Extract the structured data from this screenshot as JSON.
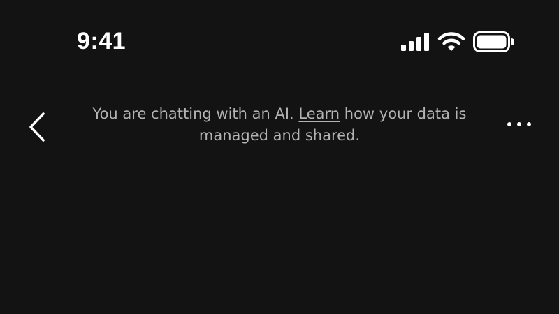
{
  "status_bar": {
    "time": "9:41",
    "icons": [
      "cellular-signal-icon",
      "wifi-icon",
      "battery-icon"
    ]
  },
  "header": {
    "back_icon": "chevron-left-icon",
    "more_icon": "more-horizontal-icon",
    "disclaimer": {
      "before": "You are chatting with an AI. ",
      "link": "Learn",
      "after": " how your data is managed and shared."
    }
  },
  "colors": {
    "background": "#131314",
    "primary_text": "#ffffff",
    "secondary_text": "#b3b3b3"
  }
}
